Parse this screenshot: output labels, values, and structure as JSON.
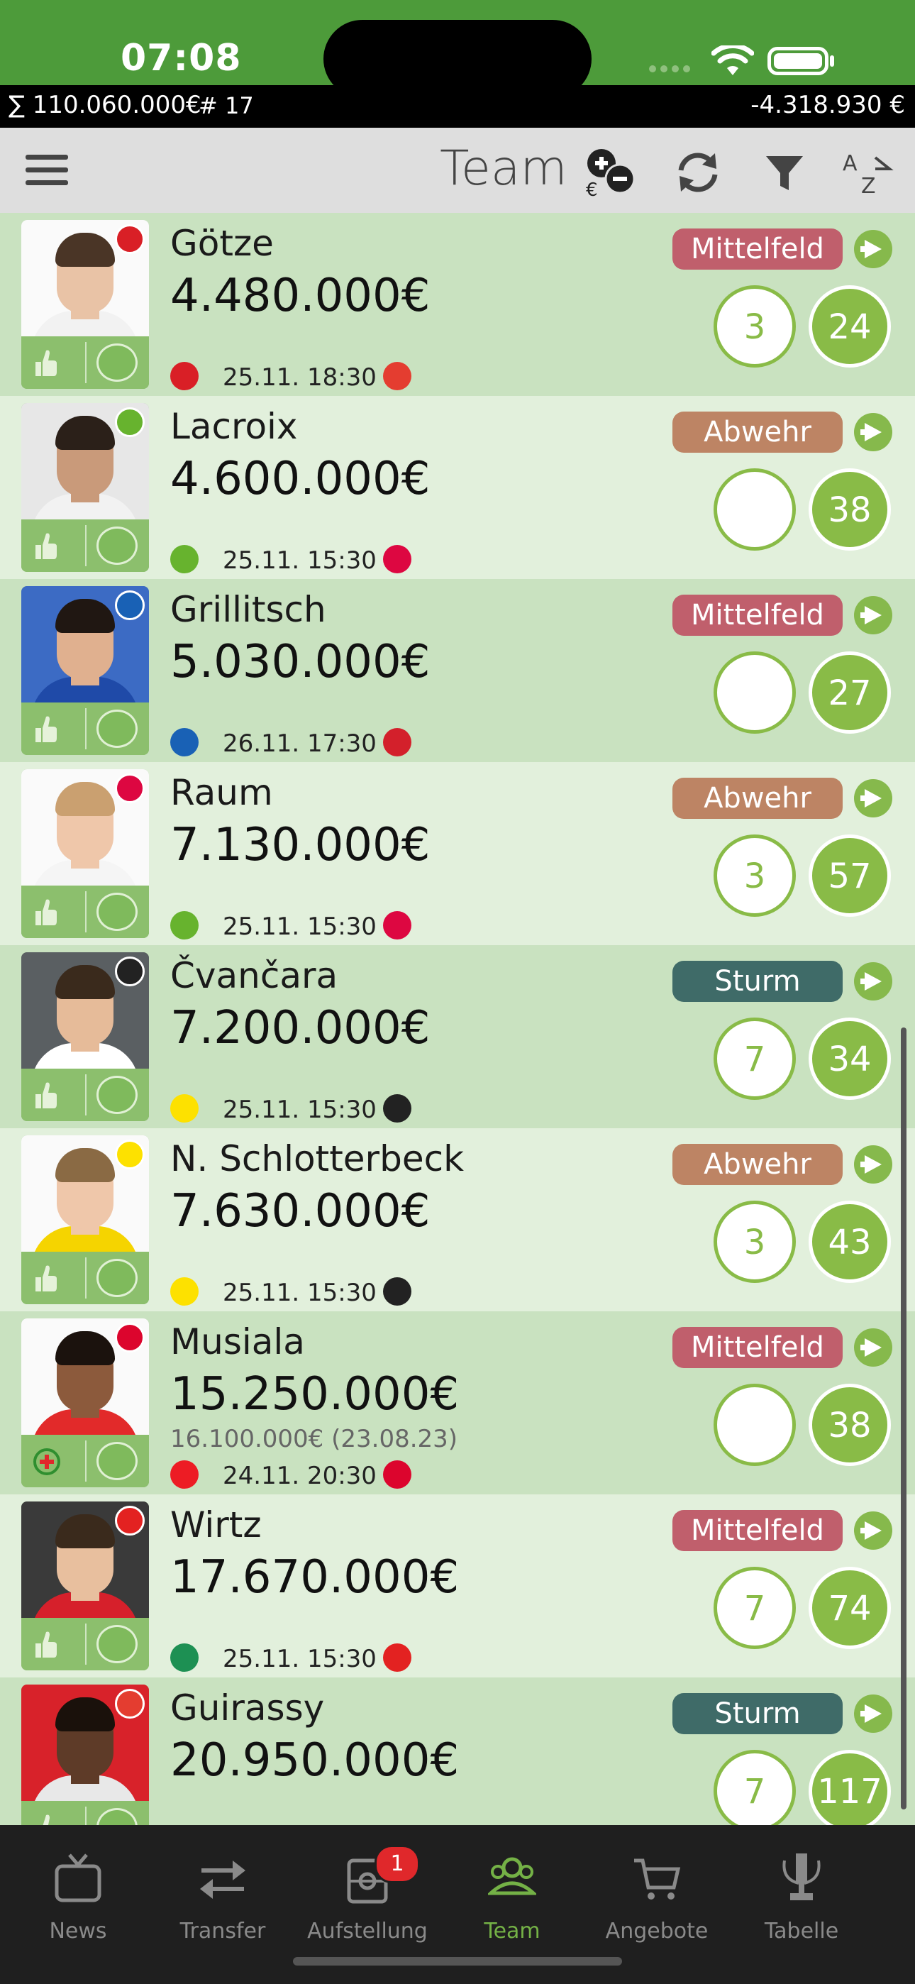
{
  "status_bar": {
    "time": "07:08"
  },
  "summary": {
    "total": "∑ 110.060.000€",
    "count": "# 17",
    "balance": "-4.318.930 €"
  },
  "toolbar": {
    "title": "Team"
  },
  "colors": {
    "accent": "#89bb47",
    "midfield": "#c05f6c",
    "defense": "#bd8464",
    "attack": "#3f6b68",
    "active_tab": "#74b146"
  },
  "players": [
    {
      "name": "Götze",
      "value": "4.480.000€",
      "old_value": "",
      "match_time": "25.11. 18:30",
      "position": "Mittelfeld",
      "points_small": "3",
      "points_big": "24"
    },
    {
      "name": "Lacroix",
      "value": "4.600.000€",
      "old_value": "",
      "match_time": "25.11. 15:30",
      "position": "Abwehr",
      "points_small": "",
      "points_big": "38"
    },
    {
      "name": "Grillitsch",
      "value": "5.030.000€",
      "old_value": "",
      "match_time": "26.11. 17:30",
      "position": "Mittelfeld",
      "points_small": "",
      "points_big": "27"
    },
    {
      "name": "Raum",
      "value": "7.130.000€",
      "old_value": "",
      "match_time": "25.11. 15:30",
      "position": "Abwehr",
      "points_small": "3",
      "points_big": "57"
    },
    {
      "name": "Čvančara",
      "value": "7.200.000€",
      "old_value": "",
      "match_time": "25.11. 15:30",
      "position": "Sturm",
      "points_small": "7",
      "points_big": "34"
    },
    {
      "name": "N. Schlotterbeck",
      "value": "7.630.000€",
      "old_value": "",
      "match_time": "25.11. 15:30",
      "position": "Abwehr",
      "points_small": "3",
      "points_big": "43"
    },
    {
      "name": "Musiala",
      "value": "15.250.000€",
      "old_value": "16.100.000€ (23.08.23)",
      "match_time": "24.11. 20:30",
      "position": "Mittelfeld",
      "points_small": "",
      "points_big": "38"
    },
    {
      "name": "Wirtz",
      "value": "17.670.000€",
      "old_value": "",
      "match_time": "25.11. 15:30",
      "position": "Mittelfeld",
      "points_small": "7",
      "points_big": "74"
    },
    {
      "name": "Guirassy",
      "value": "20.950.000€",
      "old_value": "",
      "match_time": "",
      "position": "Sturm",
      "points_small": "7",
      "points_big": "117"
    }
  ],
  "tabs": [
    {
      "label": "News",
      "icon": "tv-icon"
    },
    {
      "label": "Transfer",
      "icon": "transfer-arrows-icon"
    },
    {
      "label": "Aufstellung",
      "icon": "lineup-icon",
      "badge": "1"
    },
    {
      "label": "Team",
      "icon": "team-icon",
      "active": true
    },
    {
      "label": "Angebote",
      "icon": "cart-icon"
    },
    {
      "label": "Tabelle",
      "icon": "trophy-icon"
    }
  ]
}
